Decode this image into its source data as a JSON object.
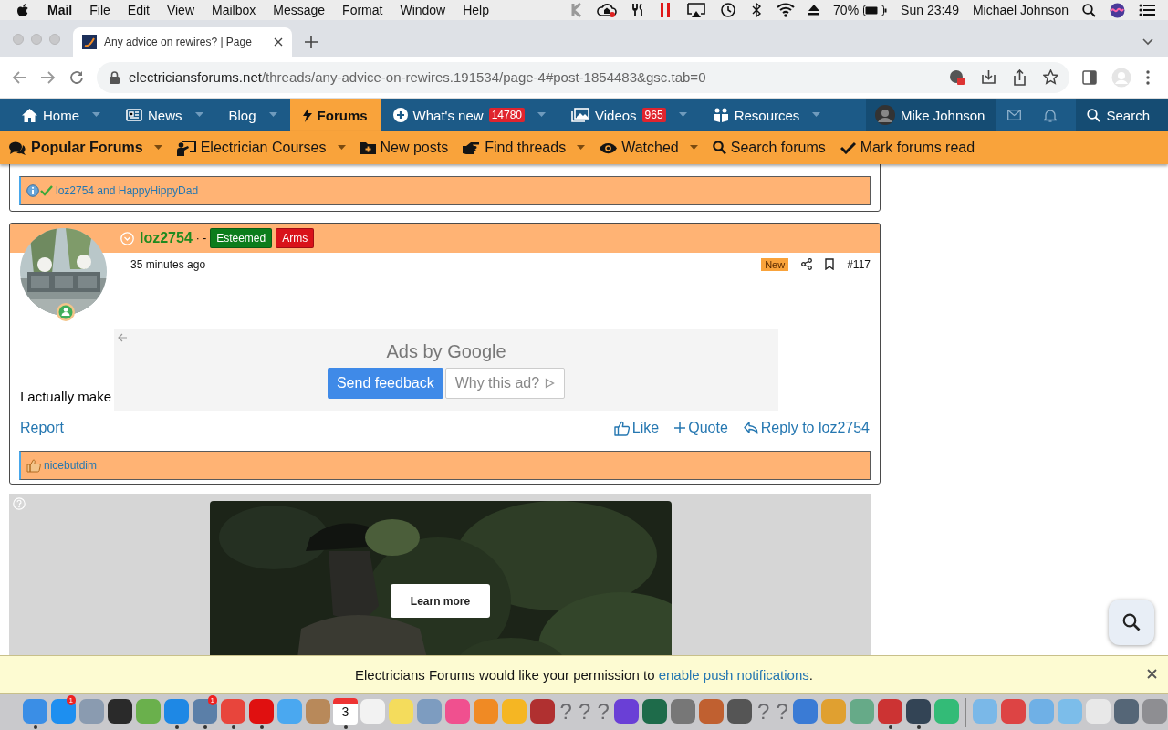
{
  "menubar": {
    "app": "Mail",
    "menus": [
      "File",
      "Edit",
      "View",
      "Mailbox",
      "Message",
      "Format",
      "Window",
      "Help"
    ],
    "battery": "70%",
    "clock": "Sun 23:49",
    "user": "Michael Johnson"
  },
  "browser": {
    "tab": {
      "title": "Any advice on rewires? | Page"
    },
    "url": {
      "domain": "electriciansforums.net",
      "path": "/threads/any-advice-on-rewires.191534/page-4#post-1854483&gsc.tab=0"
    }
  },
  "nav": {
    "items": [
      {
        "label": "Home",
        "selected": false,
        "dropdown": true
      },
      {
        "label": "News",
        "selected": false,
        "dropdown": true
      },
      {
        "label": "Blog",
        "selected": false,
        "dropdown": true
      },
      {
        "label": "Forums",
        "selected": true,
        "dropdown": false
      },
      {
        "label": "What's new",
        "badge": "14780",
        "selected": false,
        "dropdown": true
      },
      {
        "label": "Videos",
        "badge": "965",
        "selected": false,
        "dropdown": true
      },
      {
        "label": "Resources",
        "selected": false,
        "dropdown": true
      }
    ],
    "user": "Mike Johnson",
    "search": "Search"
  },
  "subnav": {
    "items": [
      {
        "label": "Popular Forums",
        "selected": true,
        "dropdown": true
      },
      {
        "label": "Electrician Courses",
        "selected": false,
        "dropdown": true
      },
      {
        "label": "New posts",
        "selected": false,
        "dropdown": false
      },
      {
        "label": "Find threads",
        "selected": false,
        "dropdown": true
      },
      {
        "label": "Watched",
        "selected": false,
        "dropdown": true
      },
      {
        "label": "Search forums",
        "selected": false,
        "dropdown": false
      },
      {
        "label": "Mark forums read",
        "selected": false,
        "dropdown": false
      }
    ]
  },
  "posts": [
    {
      "reactions": {
        "kind": "info",
        "text": "loz2754 and HappyHippyDad"
      }
    },
    {
      "username": "loz2754",
      "separator": "· -",
      "banners": [
        {
          "label": "Esteemed",
          "color": "#0b7d1c"
        },
        {
          "label": "Arms",
          "color": "#d9121a"
        }
      ],
      "time": "35 minutes ago",
      "new_label": "New",
      "number": "#117",
      "body": "I actually make",
      "ad": {
        "title": "Ads by Google",
        "feedback": "Send feedback",
        "why": "Why this ad?"
      },
      "actions": {
        "report": "Report",
        "like": "Like",
        "quote": "Quote",
        "reply": "Reply to loz2754"
      },
      "reactions": {
        "kind": "like",
        "text": "nicebutdim"
      }
    }
  ],
  "video_ad": {
    "button": "Learn more"
  },
  "notification": {
    "text": "Electricians Forums would like your permission to",
    "link": "enable push notifications",
    "end": "."
  },
  "dock": {
    "items": [
      {
        "kind": "app",
        "color": "#3a8ee6",
        "running": true
      },
      {
        "kind": "app",
        "color": "#1d8ff0",
        "badge": "1",
        "running": false
      },
      {
        "kind": "app",
        "color": "#8a9bb0",
        "running": false
      },
      {
        "kind": "app",
        "color": "#2a2a2a",
        "running": false
      },
      {
        "kind": "app",
        "color": "#6ab04c",
        "running": false
      },
      {
        "kind": "app",
        "color": "#1e88e5",
        "running": true
      },
      {
        "kind": "app",
        "color": "#5b7fa8",
        "badge": "1",
        "running": true
      },
      {
        "kind": "app",
        "color": "#e8453c",
        "running": true
      },
      {
        "kind": "app",
        "color": "#e01010",
        "running": true
      },
      {
        "kind": "app",
        "color": "#4aa8f0",
        "running": false
      },
      {
        "kind": "app",
        "color": "#b8895a",
        "running": false
      },
      {
        "kind": "calendar",
        "label": "3",
        "running": true
      },
      {
        "kind": "app",
        "color": "#f2f2f2",
        "running": false
      },
      {
        "kind": "app",
        "color": "#f4dc5c",
        "running": false
      },
      {
        "kind": "app",
        "color": "#7d9cc0",
        "running": false
      },
      {
        "kind": "app",
        "color": "#f0508f",
        "running": false
      },
      {
        "kind": "app",
        "color": "#f08a24",
        "running": false
      },
      {
        "kind": "app",
        "color": "#f5b623",
        "running": false
      },
      {
        "kind": "app",
        "color": "#b03030",
        "running": false
      },
      {
        "kind": "missing",
        "label": "?",
        "running": false
      },
      {
        "kind": "missing",
        "label": "?",
        "running": false
      },
      {
        "kind": "missing",
        "label": "?",
        "running": false
      },
      {
        "kind": "app",
        "color": "#6a3fd6",
        "running": false
      },
      {
        "kind": "app",
        "color": "#1e6b4a",
        "running": false
      },
      {
        "kind": "app",
        "color": "#777777",
        "running": false
      },
      {
        "kind": "app",
        "color": "#c06030",
        "running": false
      },
      {
        "kind": "app",
        "color": "#555555",
        "running": false
      },
      {
        "kind": "missing",
        "label": "?",
        "running": false
      },
      {
        "kind": "missing",
        "label": "?",
        "running": false
      },
      {
        "kind": "app",
        "color": "#3a7bd5",
        "running": false
      },
      {
        "kind": "app",
        "color": "#e0a030",
        "running": false
      },
      {
        "kind": "app",
        "color": "#66aa88",
        "running": false
      },
      {
        "kind": "app",
        "color": "#cc3333",
        "running": true
      },
      {
        "kind": "app",
        "color": "#334455",
        "running": true
      },
      {
        "kind": "app",
        "color": "#33bb77",
        "running": false
      },
      {
        "kind": "separator"
      },
      {
        "kind": "app",
        "color": "#7ab8e8",
        "running": false
      },
      {
        "kind": "app",
        "color": "#dd4444",
        "running": false
      },
      {
        "kind": "app",
        "color": "#6fb0e6",
        "running": false
      },
      {
        "kind": "app",
        "color": "#7cbdea",
        "running": false
      },
      {
        "kind": "app",
        "color": "#e8e8e8",
        "running": false
      },
      {
        "kind": "app",
        "color": "#556677",
        "running": false
      },
      {
        "kind": "app",
        "color": "#8e8e92",
        "running": false
      }
    ]
  }
}
